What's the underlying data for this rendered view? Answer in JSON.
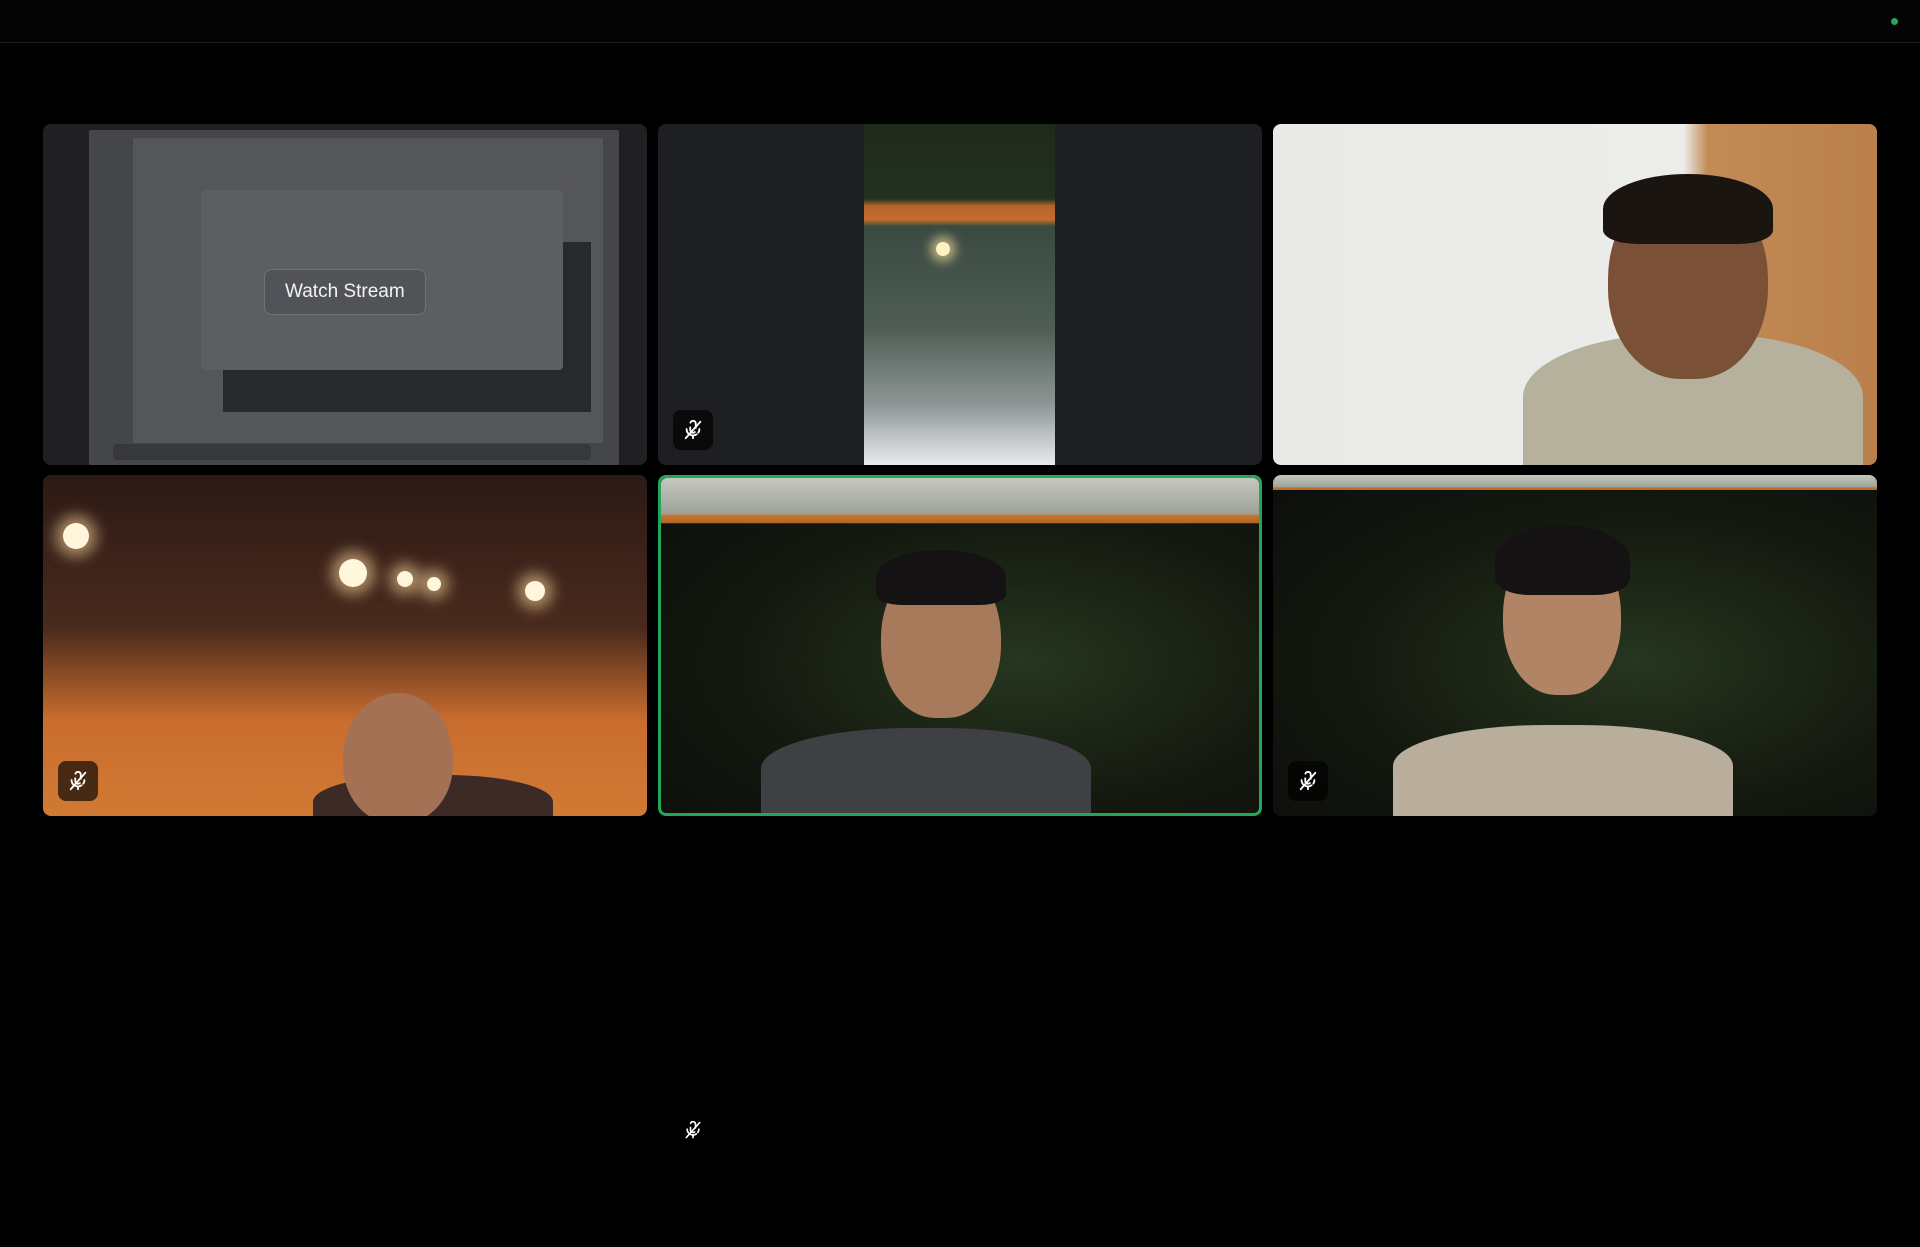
{
  "call": {
    "status_color": "#23a55a",
    "speaking_color": "#23a55a",
    "tiles": [
      {
        "kind": "screen-share",
        "action_label": "Watch Stream",
        "muted": false
      },
      {
        "kind": "camera-portrait",
        "muted": true,
        "mute_icon": "mic-muted-icon"
      },
      {
        "kind": "camera",
        "muted": false
      },
      {
        "kind": "camera",
        "muted": true,
        "mute_icon": "mic-muted-icon"
      },
      {
        "kind": "camera",
        "muted": false,
        "speaking": true
      },
      {
        "kind": "camera",
        "muted": true,
        "mute_icon": "mic-muted-icon"
      }
    ],
    "self_muted_icon": "mic-muted-icon"
  }
}
